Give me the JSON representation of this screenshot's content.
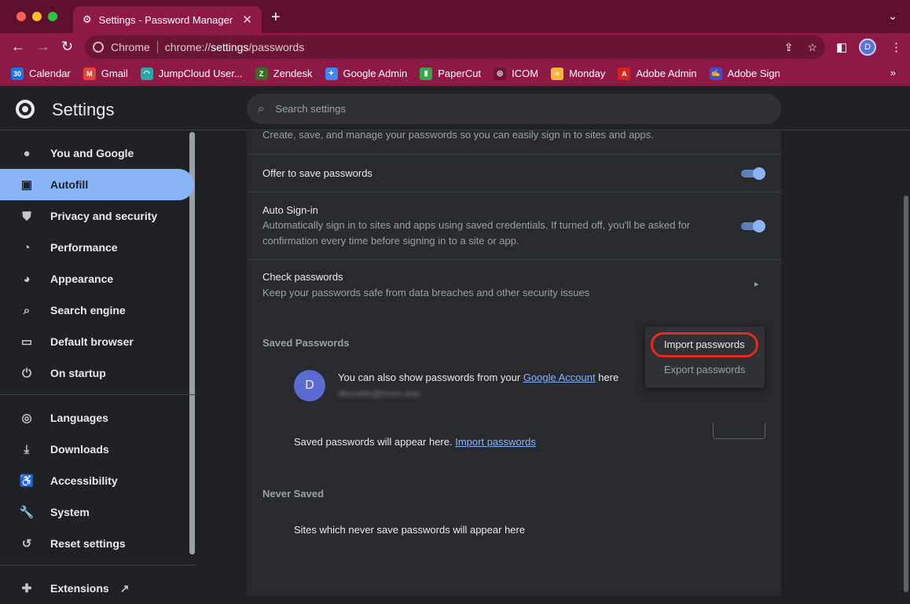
{
  "browser": {
    "tab_title": "Settings - Password Manager",
    "omnibox_chip": "Chrome",
    "url_prefix": "chrome://",
    "url_host": "settings",
    "url_path": "/passwords",
    "profile_initial": "D",
    "bookmarks": [
      {
        "label": "Calendar",
        "icon": "calendar-icon",
        "color": "#1a73e8",
        "glyph": "30"
      },
      {
        "label": "Gmail",
        "icon": "gmail-icon",
        "color": "#ea4335",
        "glyph": "M"
      },
      {
        "label": "JumpCloud User...",
        "icon": "jumpcloud-icon",
        "color": "#2aa6a6",
        "glyph": "◠"
      },
      {
        "label": "Zendesk",
        "icon": "zendesk-icon",
        "color": "#3f6b2a",
        "glyph": "Z"
      },
      {
        "label": "Google Admin",
        "icon": "google-admin-icon",
        "color": "#4285f4",
        "glyph": "✦"
      },
      {
        "label": "PaperCut",
        "icon": "papercut-icon",
        "color": "#37a84a",
        "glyph": "▮"
      },
      {
        "label": "ICOM",
        "icon": "globe-icon",
        "color": "#6b1535",
        "glyph": "◎"
      },
      {
        "label": "Monday",
        "icon": "monday-icon",
        "color": "#f6b73c",
        "glyph": "≈"
      },
      {
        "label": "Adobe Admin",
        "icon": "adobe-icon",
        "color": "#d6221b",
        "glyph": "A"
      },
      {
        "label": "Adobe Sign",
        "icon": "adobe-sign-icon",
        "color": "#4b47c9",
        "glyph": "✍"
      }
    ],
    "bookmarks_overflow": "»"
  },
  "header": {
    "title": "Settings",
    "search_placeholder": "Search settings"
  },
  "sidebar": {
    "items": [
      {
        "label": "You and Google",
        "icon": "person-icon"
      },
      {
        "label": "Autofill",
        "icon": "clipboard-icon",
        "active": true
      },
      {
        "label": "Privacy and security",
        "icon": "shield-icon"
      },
      {
        "label": "Performance",
        "icon": "speedometer-icon"
      },
      {
        "label": "Appearance",
        "icon": "palette-icon"
      },
      {
        "label": "Search engine",
        "icon": "search-icon"
      },
      {
        "label": "Default browser",
        "icon": "browser-icon"
      },
      {
        "label": "On startup",
        "icon": "power-icon"
      },
      {
        "label": "Languages",
        "icon": "globe-icon"
      },
      {
        "label": "Downloads",
        "icon": "download-icon"
      },
      {
        "label": "Accessibility",
        "icon": "accessibility-icon"
      },
      {
        "label": "System",
        "icon": "wrench-icon"
      },
      {
        "label": "Reset settings",
        "icon": "history-icon"
      },
      {
        "label": "Extensions",
        "icon": "puzzle-icon"
      }
    ]
  },
  "main": {
    "intro": "Create, save, and manage your passwords so you can easily sign in to sites and apps.",
    "offer_to_save": {
      "label": "Offer to save passwords",
      "enabled": true
    },
    "auto_signin": {
      "label": "Auto Sign-in",
      "desc_line1": "Automatically sign in to sites and apps using saved credentials. If turned off, you'll be asked for",
      "desc_line2": "confirmation every time before signing in to a site or app.",
      "enabled": true
    },
    "check_passwords": {
      "label": "Check passwords",
      "desc": "Keep your passwords safe from data breaches and other security issues"
    },
    "saved_passwords": {
      "heading": "Saved Passwords",
      "account_initial": "D",
      "account_text": "You can also show passwords from your ",
      "account_link": "Google Account",
      "account_text_after": " here",
      "account_email": "dburatto@icom.edu",
      "empty_text": "Saved passwords will appear here. ",
      "empty_link": "Import passwords"
    },
    "never_saved": {
      "heading": "Never Saved",
      "empty_text": "Sites which never save passwords will appear here"
    }
  },
  "menu": {
    "import": "Import passwords",
    "export": "Export passwords"
  },
  "colors": {
    "accent": "#8ab4f8",
    "highlight": "#e8291c",
    "frame": "#8c1a45"
  }
}
